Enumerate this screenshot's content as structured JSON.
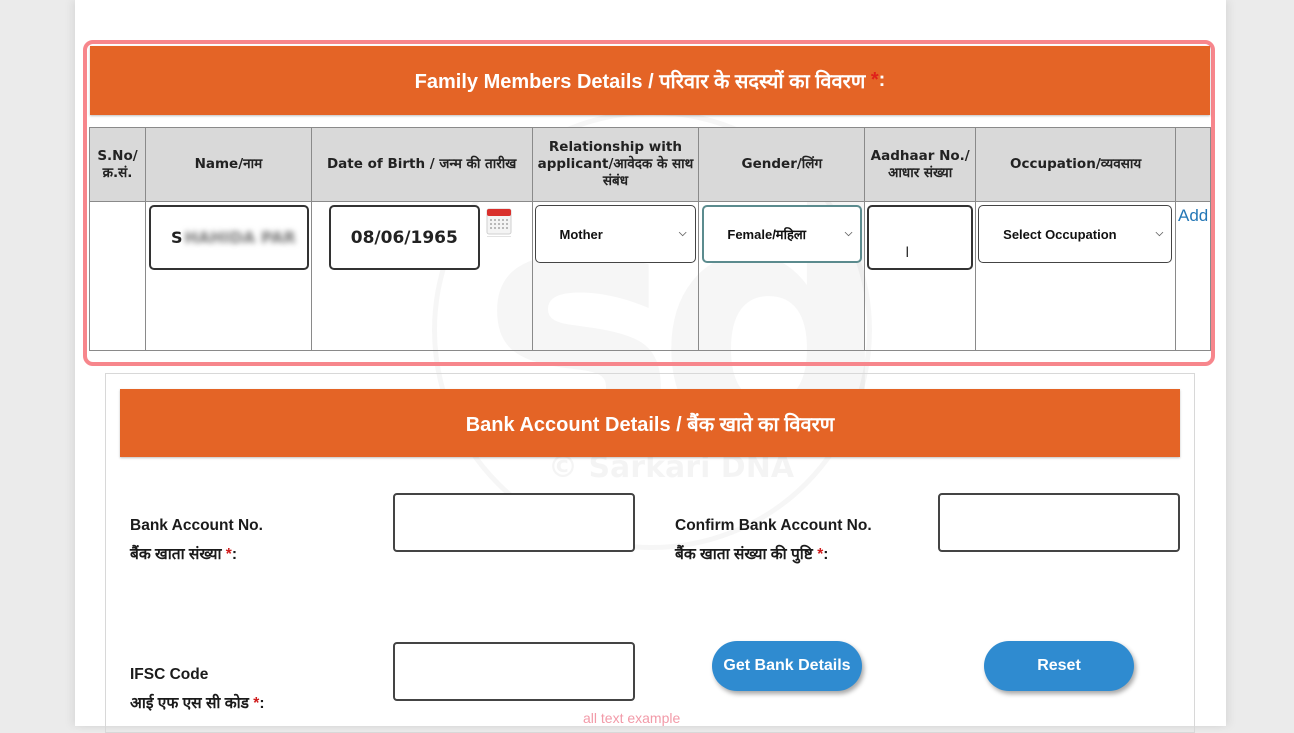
{
  "family_section": {
    "title": "Family Members Details / परिवार के सदस्यों का विवरण",
    "required_marker": "*",
    "title_suffix": ":",
    "columns": [
      {
        "line1": "S.No/",
        "line2": "क्र.सं."
      },
      {
        "line1": "Name/नाम",
        "line2": ""
      },
      {
        "line1": "Date of Birth / जन्म की तारीख",
        "line2": ""
      },
      {
        "line1": "Relationship with",
        "line2": "applicant/आवेदक के साथ",
        "line3": "संबंध"
      },
      {
        "line1": "Gender/लिंग",
        "line2": ""
      },
      {
        "line1": "Aadhaar No./",
        "line2": "आधार संख्या"
      },
      {
        "line1": "Occupation/व्यवसाय",
        "line2": ""
      },
      {
        "line1": "",
        "line2": ""
      }
    ],
    "row": {
      "sno": "",
      "name_visible": "S",
      "name_blurred": "HAHIDA PAR",
      "dob": "08/06/1965",
      "relationship": "Mother",
      "gender": "Female/महिला",
      "aadhaar": "",
      "occupation": "Select Occupation",
      "add_label": "Add"
    },
    "icons": {
      "calendar": "calendar-icon",
      "chevron": "⌵"
    }
  },
  "bank_section": {
    "title": "Bank Account Details / बैंक खाते का विवरण",
    "account_label_en": "Bank Account No.",
    "account_label_hi": "बैंक खाता संख्या",
    "confirm_label_en": "Confirm Bank Account No.",
    "confirm_label_hi": "बैंक खाता संख्या की पुष्टि",
    "ifsc_label_en": "IFSC Code",
    "ifsc_label_hi": "आई एफ एस सी कोड",
    "required_marker": "*",
    "colon": ":",
    "account_value": "",
    "confirm_value": "",
    "ifsc_value": "",
    "get_details_button": "Get Bank Details",
    "reset_button": "Reset",
    "hint_text": "all text example"
  },
  "watermark": {
    "logo": "sd",
    "text": "© Sarkari DNA"
  },
  "colors": {
    "banner": "#e46426",
    "highlight": "#f7868c",
    "button": "#2f8bd0",
    "link": "#2477b6",
    "required": "#d01c1c"
  }
}
